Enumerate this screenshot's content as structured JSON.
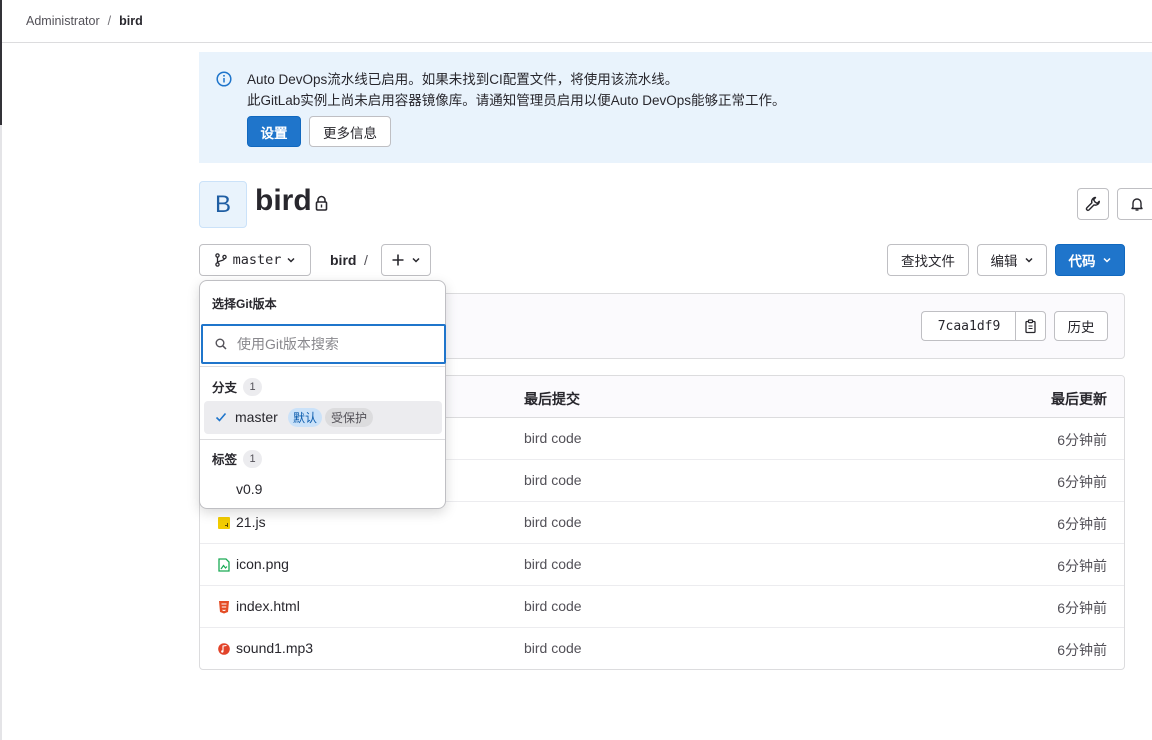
{
  "breadcrumb": {
    "parent": "Administrator",
    "separator": "/",
    "current": "bird"
  },
  "alert": {
    "line1": "Auto DevOps流水线已启用。如果未找到CI配置文件，将使用该流水线。",
    "line2": "此GitLab实例上尚未启用容器镜像库。请通知管理员启用以便Auto DevOps能够正常工作。",
    "settings_button": "设置",
    "more_info_button": "更多信息"
  },
  "project": {
    "avatar_letter": "B",
    "name": "bird"
  },
  "toolbar": {
    "branch": "master",
    "path": "bird",
    "path_sep": "/",
    "find_file": "查找文件",
    "edit": "编辑",
    "code": "代码"
  },
  "commit": {
    "sha": "7caa1df9",
    "history": "历史"
  },
  "table": {
    "headers": {
      "commit": "最后提交",
      "update": "最后更新"
    },
    "rows": [
      {
        "name": "",
        "commit": "bird code",
        "time": "6分钟前",
        "icon": "file-icon"
      },
      {
        "name": "",
        "commit": "bird code",
        "time": "6分钟前",
        "icon": "file-icon"
      },
      {
        "name": "21.js",
        "commit": "bird code",
        "time": "6分钟前",
        "icon": "js-file-icon"
      },
      {
        "name": "icon.png",
        "commit": "bird code",
        "time": "6分钟前",
        "icon": "image-file-icon"
      },
      {
        "name": "index.html",
        "commit": "bird code",
        "time": "6分钟前",
        "icon": "html-file-icon"
      },
      {
        "name": "sound1.mp3",
        "commit": "bird code",
        "time": "6分钟前",
        "icon": "audio-file-icon"
      }
    ]
  },
  "dropdown": {
    "title": "选择Git版本",
    "search_placeholder": "使用Git版本搜索",
    "branches_label": "分支",
    "branches_count": "1",
    "branch_item": "master",
    "badge_default": "默认",
    "badge_protected": "受保护",
    "tags_label": "标签",
    "tags_count": "1",
    "tag_item": "v0.9"
  },
  "colors": {
    "primary": "#1f75cb",
    "alert_bg": "#e9f3fc"
  }
}
